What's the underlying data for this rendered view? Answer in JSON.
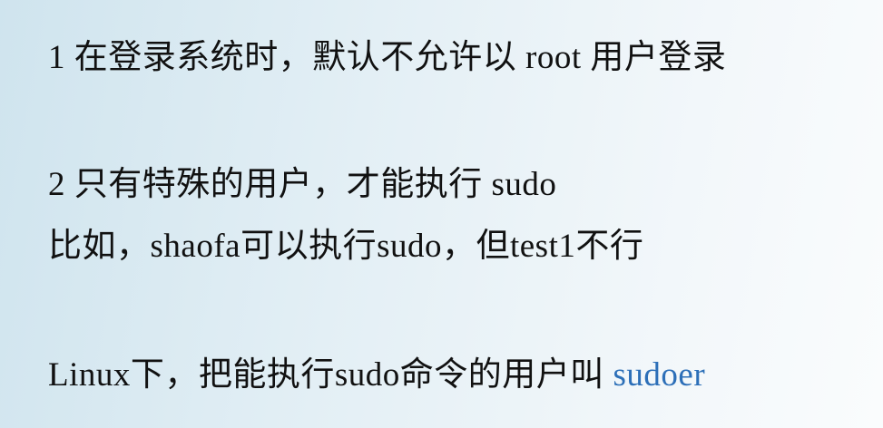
{
  "slide": {
    "line1": "1 在登录系统时，默认不允许以 root 用户登录",
    "line2": "2 只有特殊的用户，才能执行 sudo",
    "line3": "比如，shaofa可以执行sudo，但test1不行",
    "line4_prefix": "Linux下，把能执行sudo命令的用户叫 ",
    "line4_term": "sudoer"
  },
  "colors": {
    "text": "#111111",
    "accent": "#2c6fb8"
  }
}
